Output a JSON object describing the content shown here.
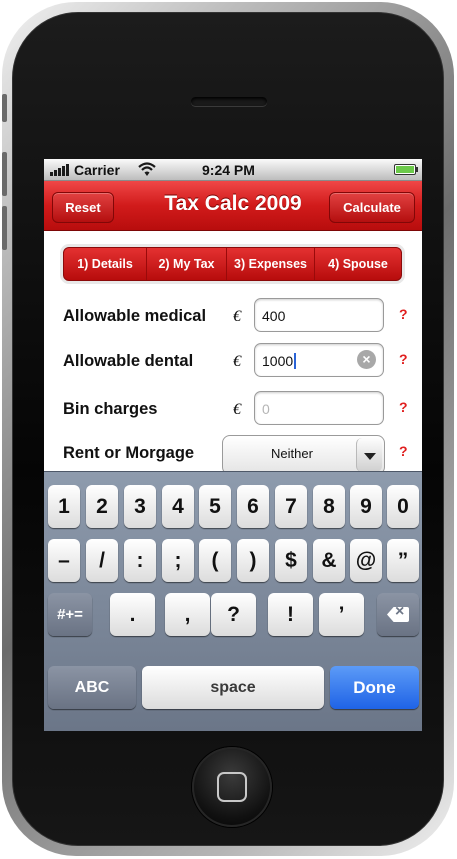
{
  "status_bar": {
    "carrier": "Carrier",
    "time": "9:24 PM"
  },
  "nav": {
    "reset": "Reset",
    "title": "Tax Calc 2009",
    "calculate": "Calculate"
  },
  "tabs": [
    {
      "label": "1) Details"
    },
    {
      "label": "2) My Tax"
    },
    {
      "label": "3) Expenses"
    },
    {
      "label": "4) Spouse"
    }
  ],
  "form": {
    "currency_symbol": "€",
    "help": "?",
    "clear": "×",
    "medical": {
      "label": "Allowable medical",
      "value": "400"
    },
    "dental": {
      "label": "Allowable dental",
      "value": "1000"
    },
    "bin": {
      "label": "Bin charges",
      "placeholder": "0"
    },
    "rent": {
      "label": "Rent or Morgage",
      "selected": "Neither"
    }
  },
  "keyboard": {
    "row1": [
      "1",
      "2",
      "3",
      "4",
      "5",
      "6",
      "7",
      "8",
      "9",
      "0"
    ],
    "row2": [
      "–",
      "/",
      ":",
      ";",
      "(",
      ")",
      "$",
      "&",
      "@",
      "”"
    ],
    "row3_shift": "#+=",
    "row3": [
      ".",
      ",",
      "?",
      "!",
      "’"
    ],
    "abc": "ABC",
    "space": "space",
    "done": "Done"
  },
  "colors": {
    "nav_red": "#d11b1b",
    "help_red": "#e01f1f",
    "done_blue": "#1f63e6"
  }
}
